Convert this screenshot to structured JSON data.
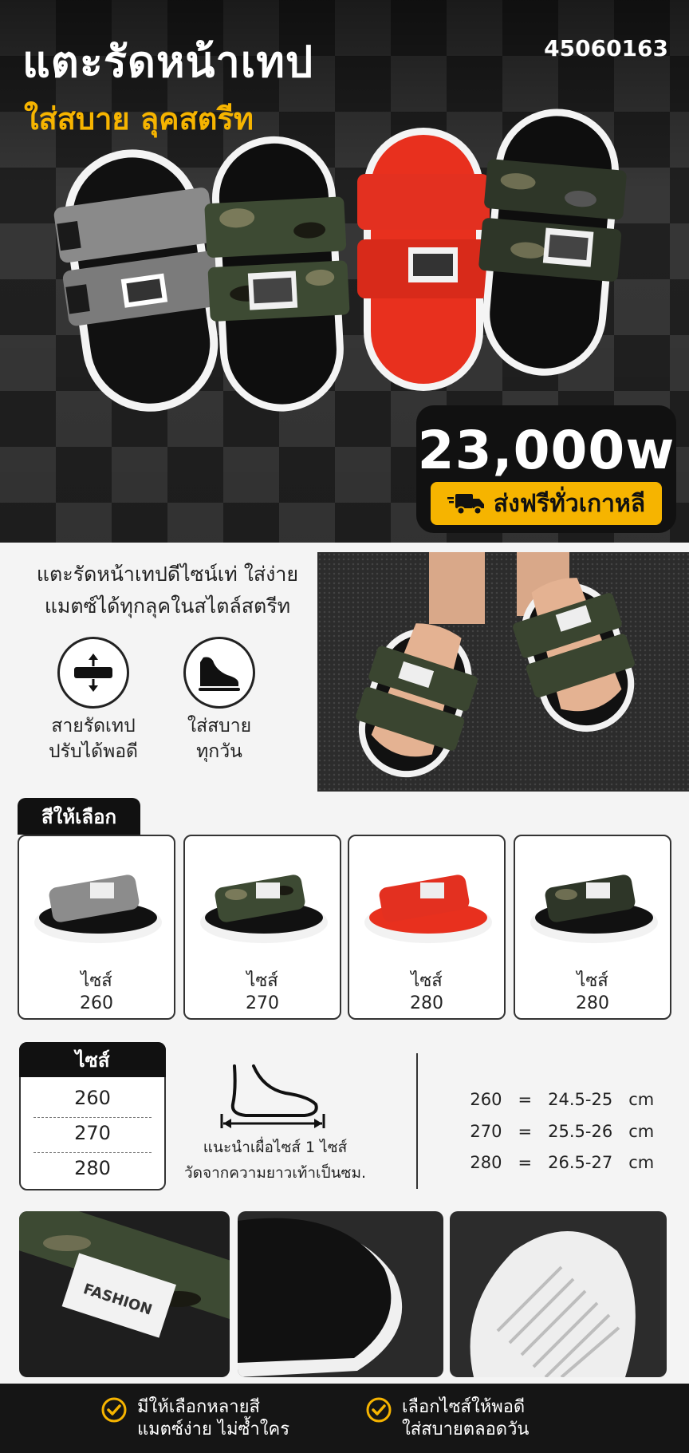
{
  "hero": {
    "title": "แตะรัดหน้าเทป",
    "subtitle": "ใส่สบาย ลุคสตรีท",
    "product_code": "45060163",
    "price": "23,000w",
    "shipping": "ส่งฟรีทั่วเกาหลี",
    "shipping_icon": "truck-icon",
    "strap_tag": "FASHION"
  },
  "features": {
    "description_lines": [
      "แตะรัดหน้าเทปดีไซน์เท่ ใส่ง่าย",
      "แมตซ์ได้ทุกลุคในสไตล์สตรีท"
    ],
    "items": [
      {
        "icon": "adjust-strap-icon",
        "lines": [
          "สายรัดเทป",
          "ปรับได้พอดี"
        ]
      },
      {
        "icon": "comfort-shoe-icon",
        "lines": [
          "ใส่สบาย",
          "ทุกวัน"
        ]
      }
    ]
  },
  "colors": {
    "heading": "สีให้เลือก",
    "options": [
      {
        "color_name": "gray",
        "strap_color": "#8c8c8c",
        "size_label": "ไซส์",
        "size": "260"
      },
      {
        "color_name": "black-camo",
        "strap_color": "#3d4a33",
        "size_label": "ไซส์",
        "size": "270"
      },
      {
        "color_name": "red",
        "strap_color": "#e8301e",
        "size_label": "ไซส์",
        "size": "280"
      },
      {
        "color_name": "black-camo-2",
        "strap_color": "#2e3628",
        "size_label": "ไซส์",
        "size": "280"
      }
    ]
  },
  "sizes": {
    "heading": "ไซส์",
    "list": [
      "260",
      "270",
      "280"
    ],
    "guide_lines": [
      "แนะนำเผื่อไซส์ 1 ไซส์",
      "วัดจากความยาวเท้าเป็นซม."
    ],
    "chart": [
      {
        "size": "260",
        "eq": "=",
        "length": "24.5-25",
        "unit": "cm"
      },
      {
        "size": "270",
        "eq": "=",
        "length": "25.5-26",
        "unit": "cm"
      },
      {
        "size": "280",
        "eq": "=",
        "length": "26.5-27",
        "unit": "cm"
      }
    ]
  },
  "bottom": {
    "items": [
      {
        "icon": "check-circle-icon",
        "lines": [
          "มีให้เลือกหลายสี",
          "แมตซ์ง่าย ไม่ซ้ำใคร"
        ]
      },
      {
        "icon": "check-circle-icon",
        "lines": [
          "เลือกไซส์ให้พอดี",
          "ใส่สบายตลอดวัน"
        ]
      }
    ]
  },
  "colors_palette": {
    "accent": "#f6b400",
    "dark": "#111111"
  }
}
